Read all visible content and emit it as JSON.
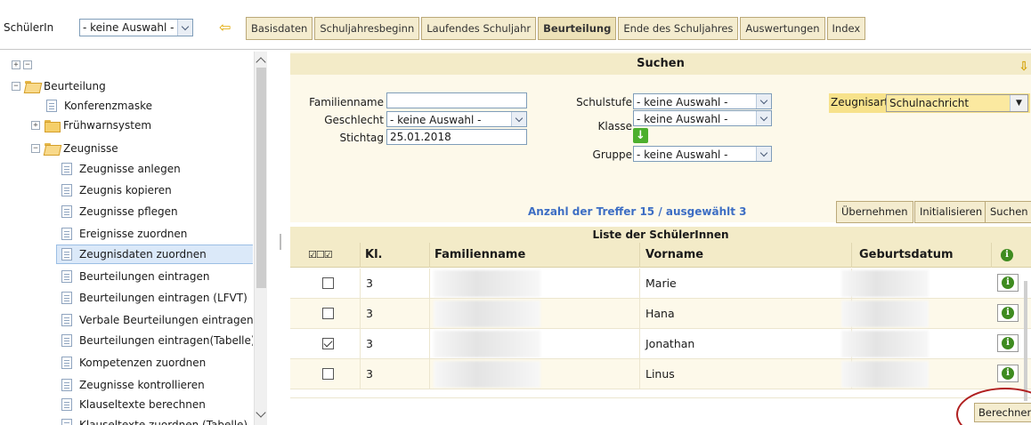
{
  "topbar": {
    "schueler_label": "SchülerIn",
    "schueler_select": "- keine Auswahl -",
    "tabs": [
      {
        "label": "Basisdaten"
      },
      {
        "label": "Schuljahresbeginn"
      },
      {
        "label": "Laufendes Schuljahr"
      },
      {
        "label": "Beurteilung",
        "active": true
      },
      {
        "label": "Ende des Schuljahres"
      },
      {
        "label": "Auswertungen"
      },
      {
        "label": "Index"
      }
    ]
  },
  "sidebar": {
    "root": "Beurteilung",
    "konferenzmaske": "Konferenzmaske",
    "fruehwarnsystem": "Frühwarnsystem",
    "zeugnisse": "Zeugnisse",
    "items": [
      {
        "label": "Zeugnisse anlegen"
      },
      {
        "label": "Zeugnis kopieren"
      },
      {
        "label": "Zeugnisse pflegen"
      },
      {
        "label": "Ereignisse zuordnen"
      },
      {
        "label": "Zeugnisdaten zuordnen",
        "selected": true
      },
      {
        "label": "Beurteilungen eintragen"
      },
      {
        "label": "Beurteilungen eintragen (LFVT)"
      },
      {
        "label": "Verbale Beurteilungen eintragen"
      },
      {
        "label": "Beurteilungen eintragen(Tabelle)"
      },
      {
        "label": "Kompetenzen zuordnen"
      },
      {
        "label": "Zeugnisse kontrollieren"
      },
      {
        "label": "Klauseltexte berechnen"
      },
      {
        "label": "Klauseltexte zuordnen (Tabelle)"
      }
    ]
  },
  "search": {
    "title": "Suchen",
    "familienname_label": "Familienname",
    "familienname_value": "",
    "geschlecht_label": "Geschlecht",
    "geschlecht_value": "- keine Auswahl -",
    "stichtag_label": "Stichtag",
    "stichtag_value": "25.01.2018",
    "schulstufe_label": "Schulstufe",
    "schulstufe_value": "- keine Auswahl -",
    "klasse_label": "Klasse",
    "klasse_value": "- keine Auswahl -",
    "gruppe_label": "Gruppe",
    "gruppe_value": "- keine Auswahl -",
    "zeugnisart_label": "Zeugnisart",
    "zeugnisart_value": "Schulnachricht",
    "treffer_text": "Anzahl der Treffer  15 / ausgewählt  3",
    "buttons": {
      "uebernehmen": "Übernehmen",
      "initialisieren": "Initialisieren",
      "suchen": "Suchen"
    }
  },
  "table": {
    "title": "Liste der SchülerInnen",
    "columns": {
      "kl": "Kl.",
      "familienname": "Familienname",
      "vorname": "Vorname",
      "geburtsdatum": "Geburtsdatum"
    },
    "rows": [
      {
        "checked": false,
        "kl": "3",
        "vorname": "Marie"
      },
      {
        "checked": false,
        "kl": "3",
        "vorname": "Hana"
      },
      {
        "checked": true,
        "kl": "3",
        "vorname": "Jonathan"
      },
      {
        "checked": false,
        "kl": "3",
        "vorname": "Linus"
      }
    ]
  },
  "footer": {
    "berechnen": "Berechnen"
  },
  "colors": {
    "panel": "#fdf9ea",
    "header": "#f3ebc8",
    "highlight": "#f7e28b",
    "treffer": "#3d6ec4",
    "annotation": "#b02020"
  }
}
